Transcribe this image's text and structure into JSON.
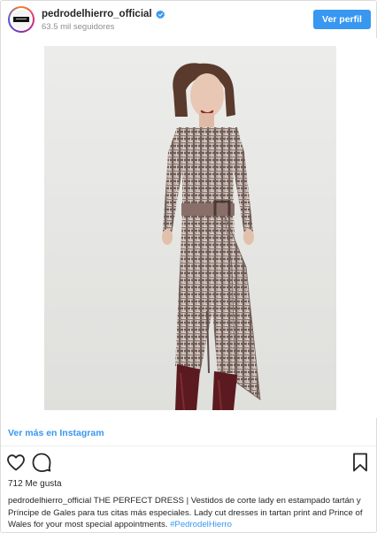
{
  "header": {
    "username": "pedrodelhierro_official",
    "followers": "63.5 mil seguidores",
    "follow_button": "Ver perfil",
    "verified": true
  },
  "photo": {
    "alt_subject": "model-in-tartan-dress"
  },
  "view_more_link": "Ver más en Instagram",
  "actions": {
    "like_icon": "heart-outline-icon",
    "comment_icon": "comment-bubble-icon",
    "save_icon": "bookmark-outline-icon"
  },
  "likes": "712 Me gusta",
  "caption": {
    "username": "pedrodelhierro_official",
    "text": " THE PERFECT DRESS | Vestidos de corte lady en estampado tartán y Príncipe de Gales para tus citas más especiales. Lady cut dresses in tartan print and Prince of Wales for your most special appointments. ",
    "hashtag": "#PedrodelHierro"
  },
  "colors": {
    "accent": "#3897f0",
    "text": "#262626",
    "muted": "#8e8e8e",
    "border": "#dbdbdb"
  }
}
